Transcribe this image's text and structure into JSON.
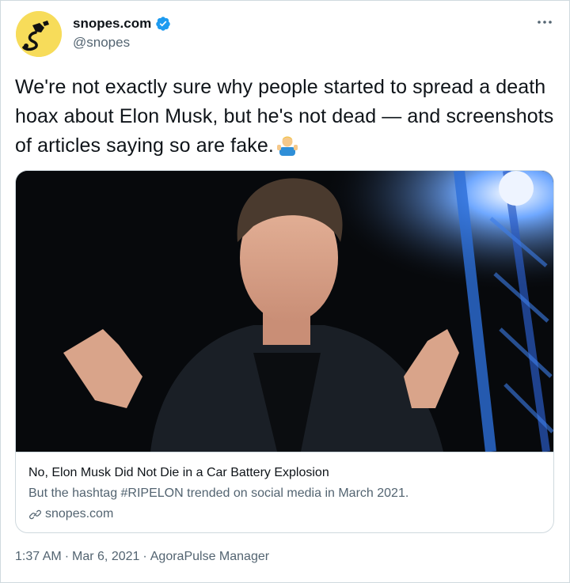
{
  "author": {
    "display_name": "snopes.com",
    "handle": "@snopes",
    "verified": true,
    "avatar_icon": "snopes-logo-icon",
    "verified_icon": "verified-badge-icon",
    "brand_color": "#f7dc5a"
  },
  "menu": {
    "more_icon": "more-horizontal-icon"
  },
  "tweet": {
    "text": "We're not exactly sure why people started to spread a death hoax about Elon Musk, but he's not dead — and screenshots of articles saying so are fake.",
    "emoji_icon": "man-shrugging-emoji-icon"
  },
  "card": {
    "image_description_icon": "photo-icon",
    "title": "No, Elon Musk Did Not Die in a Car Battery Explosion",
    "description": "But the hashtag #RIPELON trended on social media in March 2021.",
    "domain": "snopes.com",
    "link_icon": "link-icon"
  },
  "footer": {
    "time": "1:37 AM",
    "separator": "·",
    "date": "Mar 6, 2021",
    "source": "AgoraPulse Manager"
  },
  "colors": {
    "text_primary": "#0f1419",
    "text_secondary": "#536471",
    "border": "#cfd9de",
    "verified_blue": "#1d9bf0"
  }
}
